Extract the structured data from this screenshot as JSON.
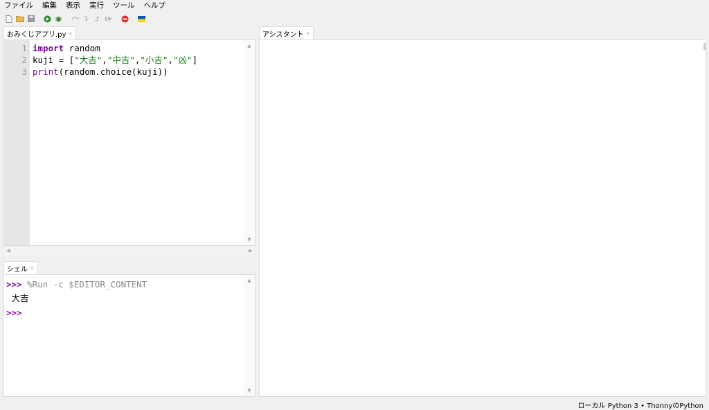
{
  "menu": [
    "ファイル",
    "編集",
    "表示",
    "実行",
    "ツール",
    "ヘルプ"
  ],
  "toolbar": {
    "icons": [
      "new-file-icon",
      "open-file-icon",
      "save-icon",
      "run-icon",
      "debug-icon",
      "step-over-icon",
      "step-into-icon",
      "step-out-icon",
      "resume-icon",
      "stop-icon",
      "ukraine-flag-icon"
    ],
    "colors": {
      "run": "#2e8b2e",
      "stop": "#d62b2b",
      "flag_blue": "#0057b7",
      "flag_yellow": "#ffd700"
    }
  },
  "editor": {
    "tab_label": "おみくじアプリ.py",
    "line_numbers": [
      "1",
      "2",
      "3"
    ],
    "lines": [
      {
        "kw": "import",
        "rest": " random"
      },
      {
        "a": "kuji = [",
        "s1": "\"大吉\"",
        "c1": ",",
        "s2": "\"中吉\"",
        "c2": ",",
        "s3": "\"小吉\"",
        "c3": ",",
        "s4": "\"凶\"",
        "end": "]"
      },
      {
        "bi": "print",
        "rest": "(random.choice(kuji))"
      }
    ]
  },
  "shell": {
    "tab_label": "シェル",
    "prompt": ">>>",
    "command": " %Run -c $EDITOR_CONTENT",
    "output": " 大吉",
    "prompt2": ">>>"
  },
  "assistant": {
    "tab_label": "アシスタント"
  },
  "status": {
    "text": "ローカル Python 3  •  ThonnyのPython"
  },
  "colors": {
    "keyword": "#7f0a9c",
    "string": "#1a7a1a",
    "gutter": "#e6e6e6",
    "background": "#f0f0f0"
  }
}
